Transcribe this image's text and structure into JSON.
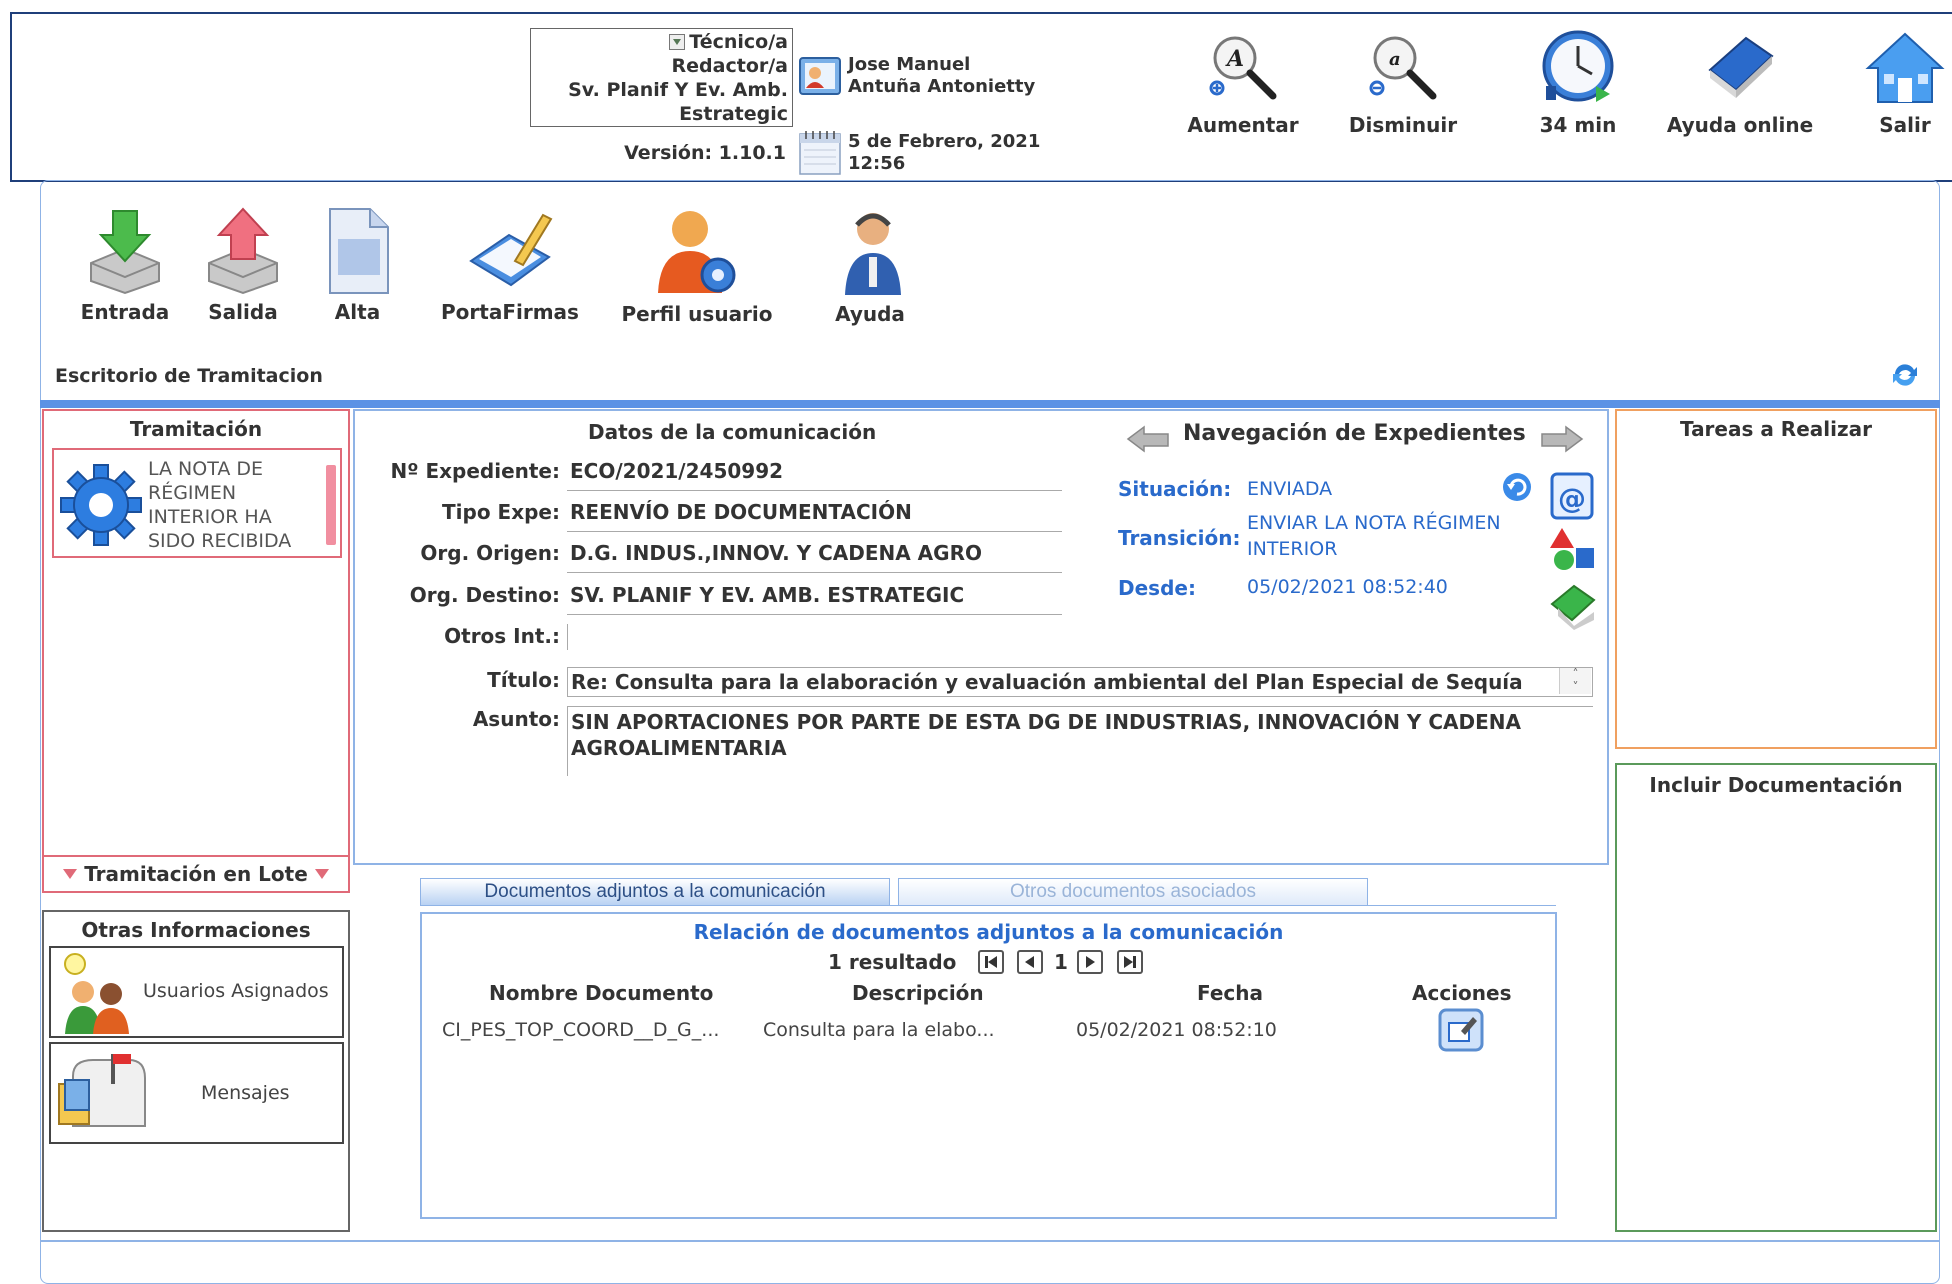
{
  "header": {
    "role": {
      "line1": "Técnico/a",
      "line2": "Redactor/a",
      "line3": "Sv. Planif Y Ev. Amb.",
      "line4": "Estrategic"
    },
    "version": "Versión: 1.10.1",
    "user": {
      "first": "Jose Manuel",
      "last": "Antuña  Antonietty"
    },
    "date": {
      "line1": "5 de Febrero, 2021",
      "line2": "12:56"
    },
    "buttons": {
      "aumentar": "Aumentar",
      "disminuir": "Disminuir",
      "session": "34 min",
      "ayuda_online": "Ayuda online",
      "salir": "Salir"
    }
  },
  "toolbar": {
    "entrada": "Entrada",
    "salida": "Salida",
    "alta": "Alta",
    "portafirmas": "PortaFirmas",
    "perfil": "Perfil usuario",
    "ayuda": "Ayuda"
  },
  "breadcrumb": "Escritorio de Tramitacion",
  "left": {
    "tramitacion_title": "Tramitación",
    "tramitacion_item": "LA NOTA DE RÉGIMEN INTERIOR HA SIDO RECIBIDA",
    "lote": "Tramitación en Lote",
    "otras_title": "Otras Informaciones",
    "usuarios": "Usuarios Asignados",
    "mensajes": "Mensajes"
  },
  "datos": {
    "title": "Datos de la comunicación",
    "labels": {
      "expediente": "Nº Expediente:",
      "tipo": "Tipo Expe:",
      "origen": "Org. Origen:",
      "destino": "Org. Destino:",
      "otros": "Otros Int.:",
      "titulo": "Título:",
      "asunto": "Asunto:"
    },
    "values": {
      "expediente": "ECO/2021/2450992",
      "tipo": "REENVÍO DE DOCUMENTACIÓN",
      "origen": "D.G. INDUS.,INNOV. Y CADENA AGRO",
      "destino": "SV. PLANIF Y EV. AMB. ESTRATEGIC",
      "otros": "",
      "titulo": "Re: Consulta para la elaboración y evaluación ambiental del Plan Especial de Sequía",
      "asunto": "SIN APORTACIONES POR PARTE DE ESTA DG DE INDUSTRIAS, INNOVACIÓN Y CADENA AGROALIMENTARIA"
    }
  },
  "navegacion": {
    "title": "Navegación de Expedientes",
    "situacion_label": "Situación:",
    "situacion": "ENVIADA",
    "transicion_label": "Transición:",
    "transicion": "ENVIAR LA NOTA RÉGIMEN INTERIOR",
    "desde_label": "Desde:",
    "desde": "05/02/2021 08:52:40"
  },
  "tabs": {
    "tab1": "Documentos adjuntos a la comunicación",
    "tab2": "Otros documentos asociados"
  },
  "documents": {
    "title": "Relación de documentos adjuntos a la comunicación",
    "count": "1 resultado",
    "page": "1",
    "columns": {
      "nombre": "Nombre Documento",
      "descripcion": "Descripción",
      "fecha": "Fecha",
      "acciones": "Acciones"
    },
    "rows": [
      {
        "nombre": "CI_PES_TOP_COORD__D_G_...",
        "descripcion": "Consulta para la elabo...",
        "fecha": "05/02/2021 08:52:10"
      }
    ]
  },
  "right": {
    "tareas": "Tareas a Realizar",
    "incluir": "Incluir Documentación"
  }
}
